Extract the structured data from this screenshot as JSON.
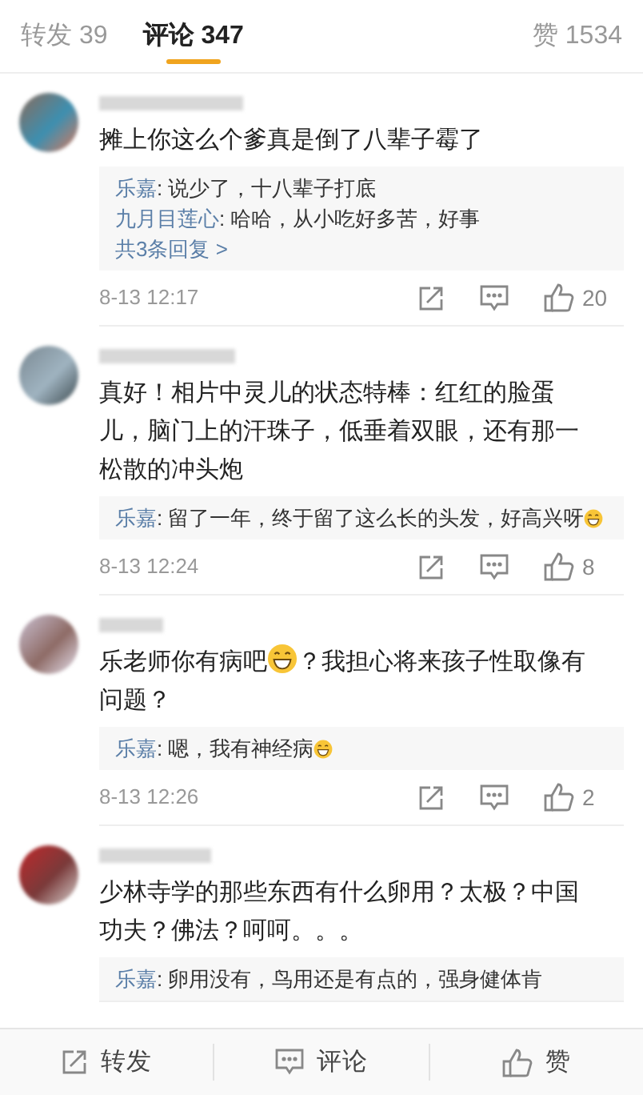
{
  "tabs": [
    {
      "label": "转发 39",
      "selected": false
    },
    {
      "label": "评论 347",
      "selected": true
    }
  ],
  "likes_tab": {
    "label": "赞 1534"
  },
  "comments": [
    {
      "segments": [
        {
          "kind": "text",
          "text": "摊上你这么个爹真是倒了八辈子霉了"
        }
      ],
      "replies": [
        {
          "author": "乐嘉",
          "text": ": 说少了，十八辈子打底"
        },
        {
          "author": "九月目莲心",
          "text": ": 哈哈，从小吃好多苦，好事"
        }
      ],
      "more_replies": "共3条回复 >",
      "time": "8-13 12:17",
      "likes": "20"
    },
    {
      "segments": [
        {
          "kind": "text",
          "text": "真好！相片中灵儿的状态特棒：红红的脸蛋儿，脑门上的汗珠子，低垂着双眼，还有那一松散的冲头炮"
        }
      ],
      "replies": [
        {
          "author": "乐嘉",
          "text": ": 留了一年，终于留了这么长的头发，好高兴呀",
          "emoji": true
        }
      ],
      "time": "8-13 12:24",
      "likes": "8"
    },
    {
      "segments": [
        {
          "kind": "text",
          "text": "乐老师你有病吧"
        },
        {
          "kind": "emoji"
        },
        {
          "kind": "text",
          "text": "？我担心将来孩子性取像有问题？"
        }
      ],
      "replies": [
        {
          "author": "乐嘉",
          "text": ": 嗯，我有神经病",
          "emoji": true
        }
      ],
      "time": "8-13 12:26",
      "likes": "2"
    },
    {
      "segments": [
        {
          "kind": "text",
          "text": "少林寺学的那些东西有什么卵用？太极？中国功夫？佛法？呵呵。。。"
        }
      ],
      "replies": [
        {
          "author": "乐嘉",
          "text": ": 卵用没有，鸟用还是有点的，强身健体肯"
        }
      ]
    }
  ],
  "bottom_bar": [
    {
      "kind": "share",
      "label": "转发"
    },
    {
      "kind": "comment",
      "label": "评论"
    },
    {
      "kind": "like",
      "label": "赞"
    }
  ]
}
